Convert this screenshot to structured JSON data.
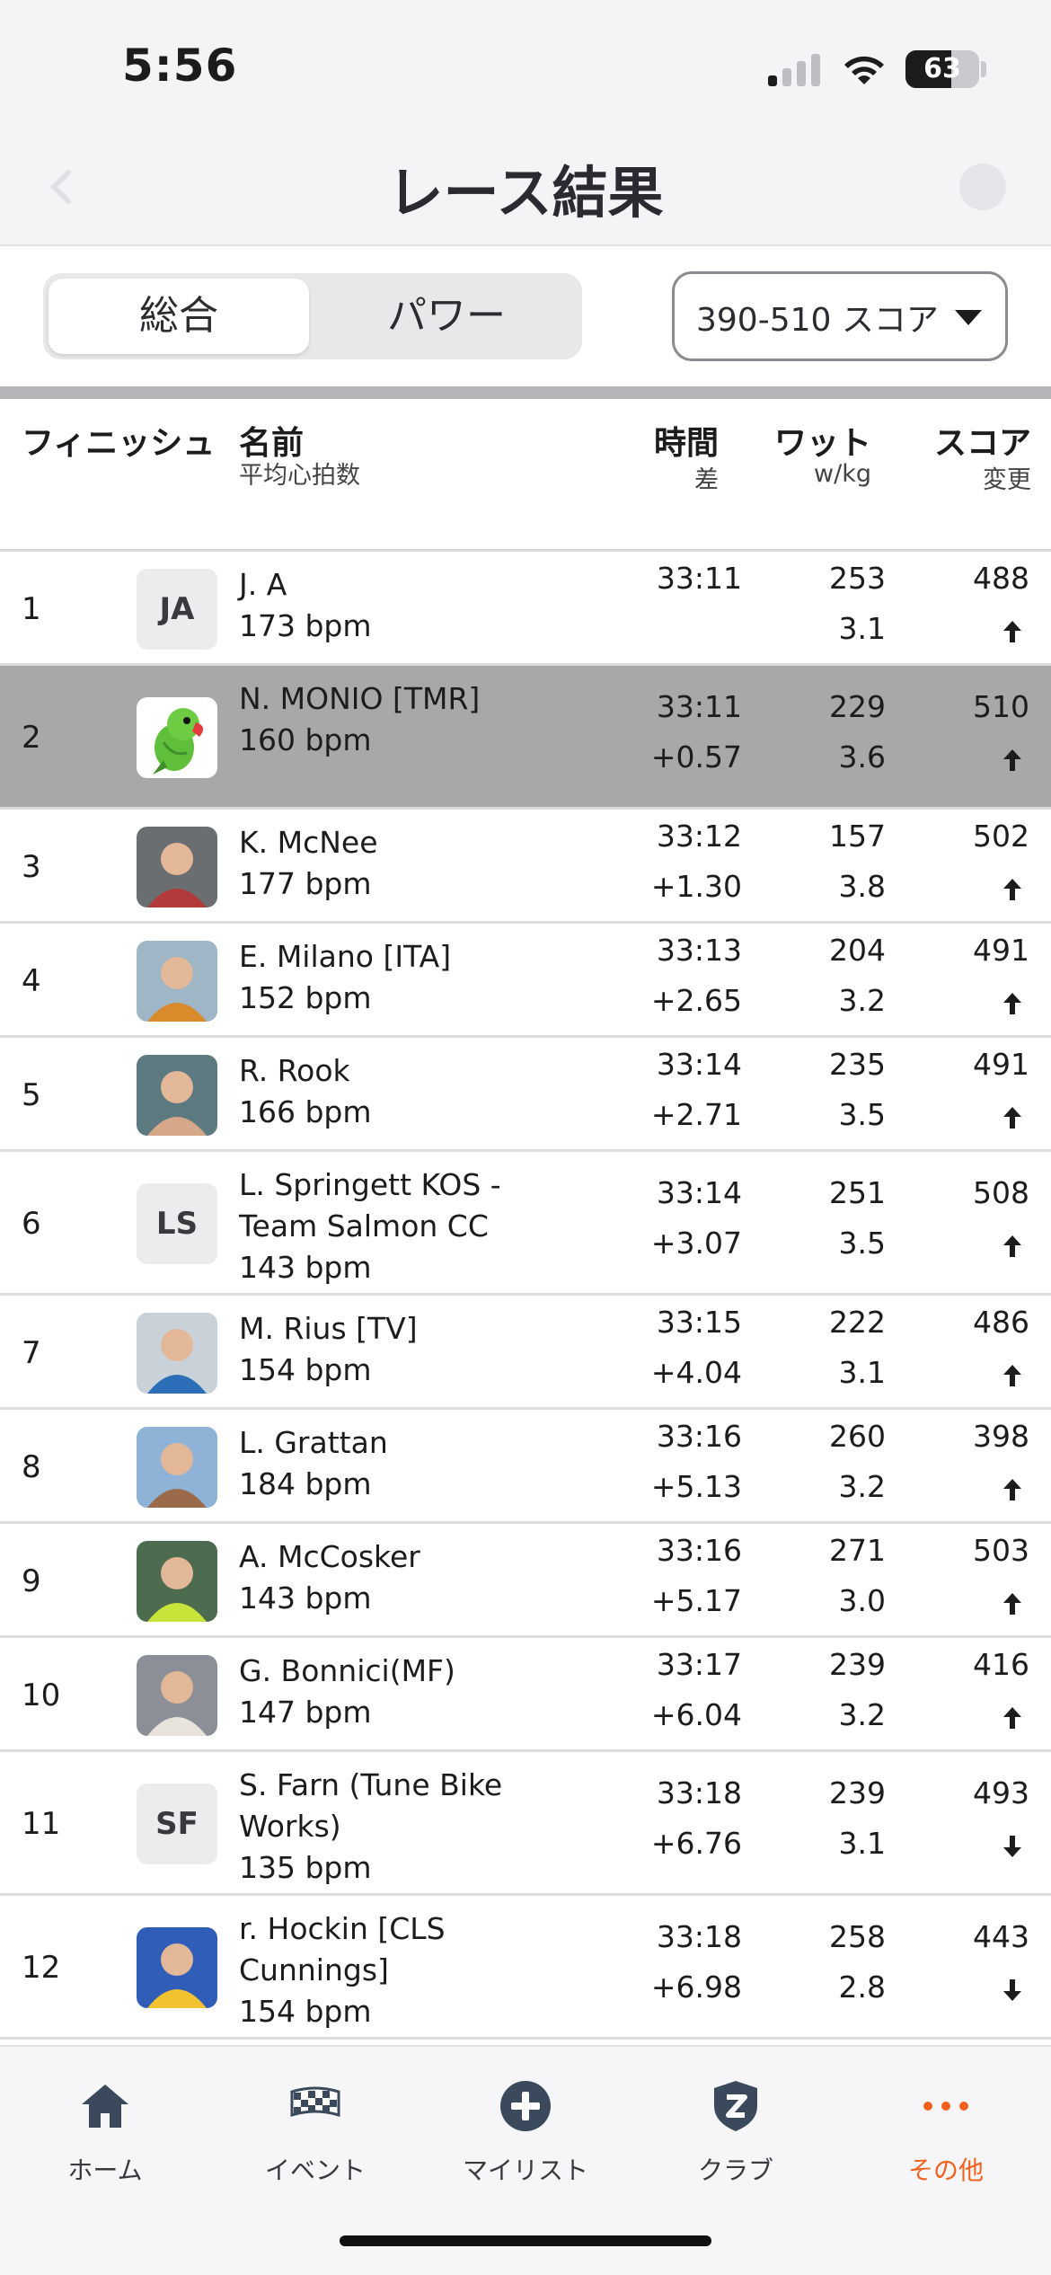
{
  "status_bar": {
    "time": "5:56",
    "battery": "63"
  },
  "header": {
    "title": "レース結果"
  },
  "filters": {
    "segments": [
      {
        "label": "総合",
        "active": true
      },
      {
        "label": "パワー",
        "active": false
      }
    ],
    "category": "390-510 スコア"
  },
  "table_header": {
    "finish": "フィニッシュ",
    "name": "名前",
    "name_sub": "平均心拍数",
    "time": "時間",
    "time_sub": "差",
    "watt": "ワット",
    "watt_sub": "w/kg",
    "score": "スコア",
    "score_sub": "変更"
  },
  "rows": [
    {
      "pos": "1",
      "avatar": {
        "type": "initials",
        "text": "JA"
      },
      "name": "J. A",
      "hr": "173 bpm",
      "time": "33:11",
      "gap": "",
      "watts": "253",
      "wkg": "3.1",
      "score": "488",
      "change": "up"
    },
    {
      "pos": "2",
      "avatar": {
        "type": "parrot"
      },
      "name": "N. MONIO [TMR]",
      "hr": " 160 bpm",
      "time": "33:11",
      "gap": "+0.57",
      "watts": "229",
      "wkg": "3.6",
      "score": "510",
      "change": "up",
      "highlight": true
    },
    {
      "pos": "3",
      "avatar": {
        "type": "photo",
        "bg": "#6b6e70",
        "fg": "#b23a3a"
      },
      "name": "K. McNee",
      "hr": "177 bpm",
      "time": "33:12",
      "gap": "+1.30",
      "watts": "157",
      "wkg": "3.8",
      "score": "502",
      "change": "up"
    },
    {
      "pos": "4",
      "avatar": {
        "type": "photo",
        "bg": "#9fb6c7",
        "fg": "#d98a2b"
      },
      "name": "E. Milano [ITA]",
      "hr": "152 bpm",
      "time": "33:13",
      "gap": "+2.65",
      "watts": "204",
      "wkg": "3.2",
      "score": "491",
      "change": "up"
    },
    {
      "pos": "5",
      "avatar": {
        "type": "photo",
        "bg": "#5d7a80",
        "fg": "#d5a88a"
      },
      "name": "R. Rook",
      "hr": "166 bpm",
      "time": "33:14",
      "gap": "+2.71",
      "watts": "235",
      "wkg": "3.5",
      "score": "491",
      "change": "up"
    },
    {
      "pos": "6",
      "avatar": {
        "type": "initials",
        "text": "LS"
      },
      "name": "L. Springett KOS - Team Salmon CC",
      "hr": "143 bpm",
      "time": "33:14",
      "gap": "+3.07",
      "watts": "251",
      "wkg": "3.5",
      "score": "508",
      "change": "up"
    },
    {
      "pos": "7",
      "avatar": {
        "type": "photo",
        "bg": "#c9d2d8",
        "fg": "#2c6fb8"
      },
      "name": "M. Rius [TV]",
      "hr": "154 bpm",
      "time": "33:15",
      "gap": "+4.04",
      "watts": "222",
      "wkg": "3.1",
      "score": "486",
      "change": "up"
    },
    {
      "pos": "8",
      "avatar": {
        "type": "photo",
        "bg": "#8fb3d6",
        "fg": "#9a6a4a"
      },
      "name": "L. Grattan",
      "hr": "184 bpm",
      "time": "33:16",
      "gap": "+5.13",
      "watts": "260",
      "wkg": "3.2",
      "score": "398",
      "change": "up"
    },
    {
      "pos": "9",
      "avatar": {
        "type": "photo",
        "bg": "#4d6b4f",
        "fg": "#c8e33a"
      },
      "name": "A. McCosker",
      "hr": "143 bpm",
      "time": "33:16",
      "gap": "+5.17",
      "watts": "271",
      "wkg": "3.0",
      "score": "503",
      "change": "up"
    },
    {
      "pos": "10",
      "avatar": {
        "type": "photo",
        "bg": "#8d8f98",
        "fg": "#e8e4dc"
      },
      "name": "G. Bonnici(MF)",
      "hr": "147 bpm",
      "time": "33:17",
      "gap": "+6.04",
      "watts": "239",
      "wkg": "3.2",
      "score": "416",
      "change": "up"
    },
    {
      "pos": "11",
      "avatar": {
        "type": "initials",
        "text": "SF"
      },
      "name": "S. Farn (Tune Bike Works)",
      "hr": "135 bpm",
      "time": "33:18",
      "gap": "+6.76",
      "watts": "239",
      "wkg": "3.1",
      "score": "493",
      "change": "down"
    },
    {
      "pos": "12",
      "avatar": {
        "type": "photo",
        "bg": "#2f5db8",
        "fg": "#f2c230"
      },
      "name": "r. Hockin [CLS Cunnings]",
      "hr": "154 bpm",
      "time": "33:18",
      "gap": "+6.98",
      "watts": "258",
      "wkg": "2.8",
      "score": "443",
      "change": "down"
    }
  ],
  "tabbar": [
    {
      "label": "ホーム",
      "icon": "home-icon"
    },
    {
      "label": "イベント",
      "icon": "checkered-flag-icon"
    },
    {
      "label": "マイリスト",
      "icon": "plus-circle-icon"
    },
    {
      "label": "クラブ",
      "icon": "club-shield-icon"
    },
    {
      "label": "その他",
      "icon": "more-dots-icon",
      "active": true
    }
  ],
  "colors": {
    "accent": "#f2621e",
    "highlight_row": "#a8a8aa"
  }
}
